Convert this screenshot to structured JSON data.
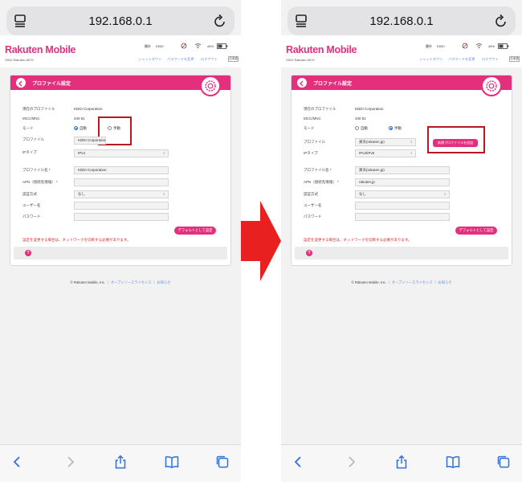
{
  "browser": {
    "url": "192.168.0.1"
  },
  "brand": {
    "name": "Rakuten",
    "name_suffix": "Mobile",
    "color": "#e4307c",
    "ssid": "SSID Rakuten-5679"
  },
  "status": {
    "signal_label": "圏外",
    "carrier": "KDDI",
    "battery": "44%"
  },
  "nav": {
    "shutdown": "シャットダウン",
    "change_password": "パスワードを変更",
    "logout": "ログアウト",
    "language": "日本語"
  },
  "panel": {
    "title": "プロファイル設定",
    "labels": {
      "current_profile": "現在のプロファイル",
      "mcc_mnc": "MCC/MNC",
      "mode": "モード",
      "profile": "プロファイル",
      "ip_type": "IPタイプ",
      "profile_name": "プロファイル名 *",
      "apn": "APN（接続先情報） *",
      "auth": "認証方式",
      "username": "ユーザー名",
      "password": "パスワード"
    },
    "mode_auto": "自動",
    "mode_manual": "手動",
    "default_button": "デフォルトとして設定",
    "warning": "設定を変更する場合は、ネットワークを切断する必要があります。",
    "help": "?",
    "new_profile_button": "新規プロファイルを追加"
  },
  "left": {
    "current_profile": "KDDI Corporation",
    "mcc_mnc": "440 51",
    "mode_selected": "auto",
    "profile_value": "KDDI Corporation",
    "ip_type_value": "IPv4",
    "profile_name_value": "KDDI Corporation",
    "apn_value": "",
    "auth_value": "なし",
    "username_value": "",
    "password_value": ""
  },
  "right": {
    "current_profile": "KDDI Corporation",
    "mcc_mnc": "440 51",
    "mode_selected": "manual",
    "profile_value": "楽天(rakuten.jp)",
    "ip_type_value": "IPv4/IPv6",
    "profile_name_value": "楽天(rakuten.jp)",
    "apn_value": "rakuten.jp",
    "auth_value": "なし",
    "username_value": "",
    "password_value": ""
  },
  "footer": {
    "copyright": "© Rakuten Mobile, Inc.",
    "oss": "オープンソースライセンス",
    "notice": "お知らせ"
  },
  "colors": {
    "accent": "#e4307c",
    "highlight": "#b51a22",
    "arrow": "#e8201f",
    "link": "#6b8fd6"
  }
}
